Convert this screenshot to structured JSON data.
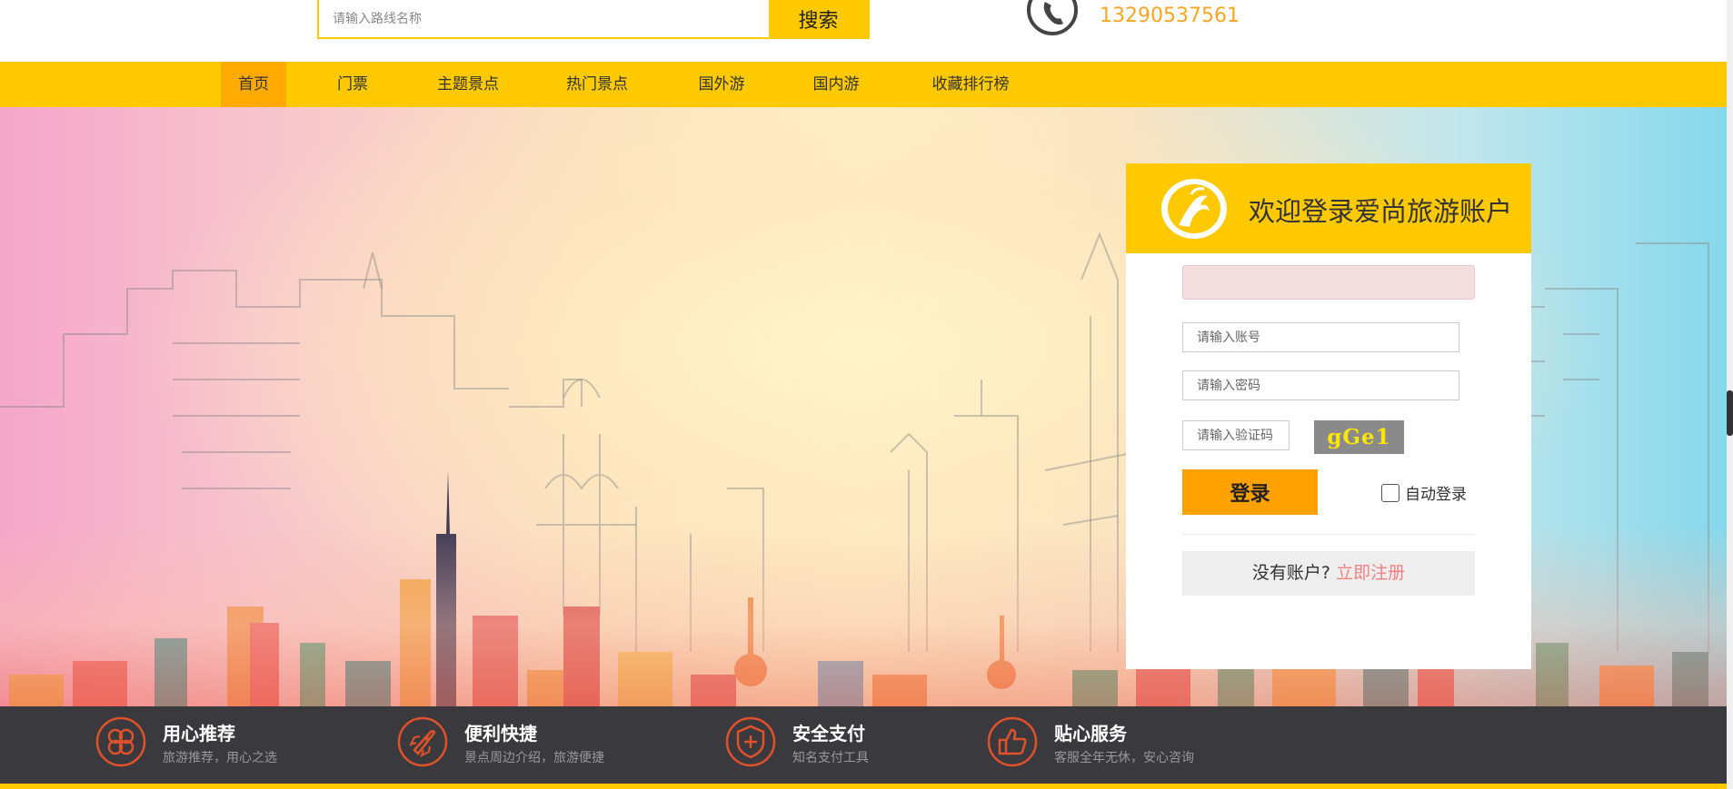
{
  "header": {
    "search_placeholder": "请输入路线名称",
    "search_button": "搜索",
    "phone_number": "13290537561"
  },
  "nav": {
    "items": [
      "首页",
      "门票",
      "主题景点",
      "热门景点",
      "国外游",
      "国内游",
      "收藏排行榜"
    ],
    "active": "首页"
  },
  "login": {
    "title": "欢迎登录爱尚旅游账户",
    "username_placeholder": "请输入账号",
    "password_placeholder": "请输入密码",
    "captcha_placeholder": "请输入验证码",
    "captcha_text": "gGe1",
    "login_button": "登录",
    "auto_login_label": "自动登录",
    "auto_login_checked": false,
    "no_account_text": "没有账户?",
    "register_link": "立即注册"
  },
  "features": [
    {
      "title": "用心推荐",
      "subtitle": "旅游推荐，用心之选",
      "icon": "four-leaf-icon"
    },
    {
      "title": "便利快捷",
      "subtitle": "景点周边介绍，旅游便捷",
      "icon": "rocket-icon"
    },
    {
      "title": "安全支付",
      "subtitle": "知名支付工具",
      "icon": "shield-icon"
    },
    {
      "title": "贴心服务",
      "subtitle": "客服全年无休，安心咨询",
      "icon": "thumbs-up-icon"
    }
  ],
  "colors": {
    "brand_yellow": "#ffc900",
    "active_nav": "#ffaa00",
    "login_button": "#ffa100",
    "phone_text": "#f5a623",
    "register_link": "#f08080",
    "features_bg": "#3a393e",
    "feature_icon": "#e0522a"
  }
}
